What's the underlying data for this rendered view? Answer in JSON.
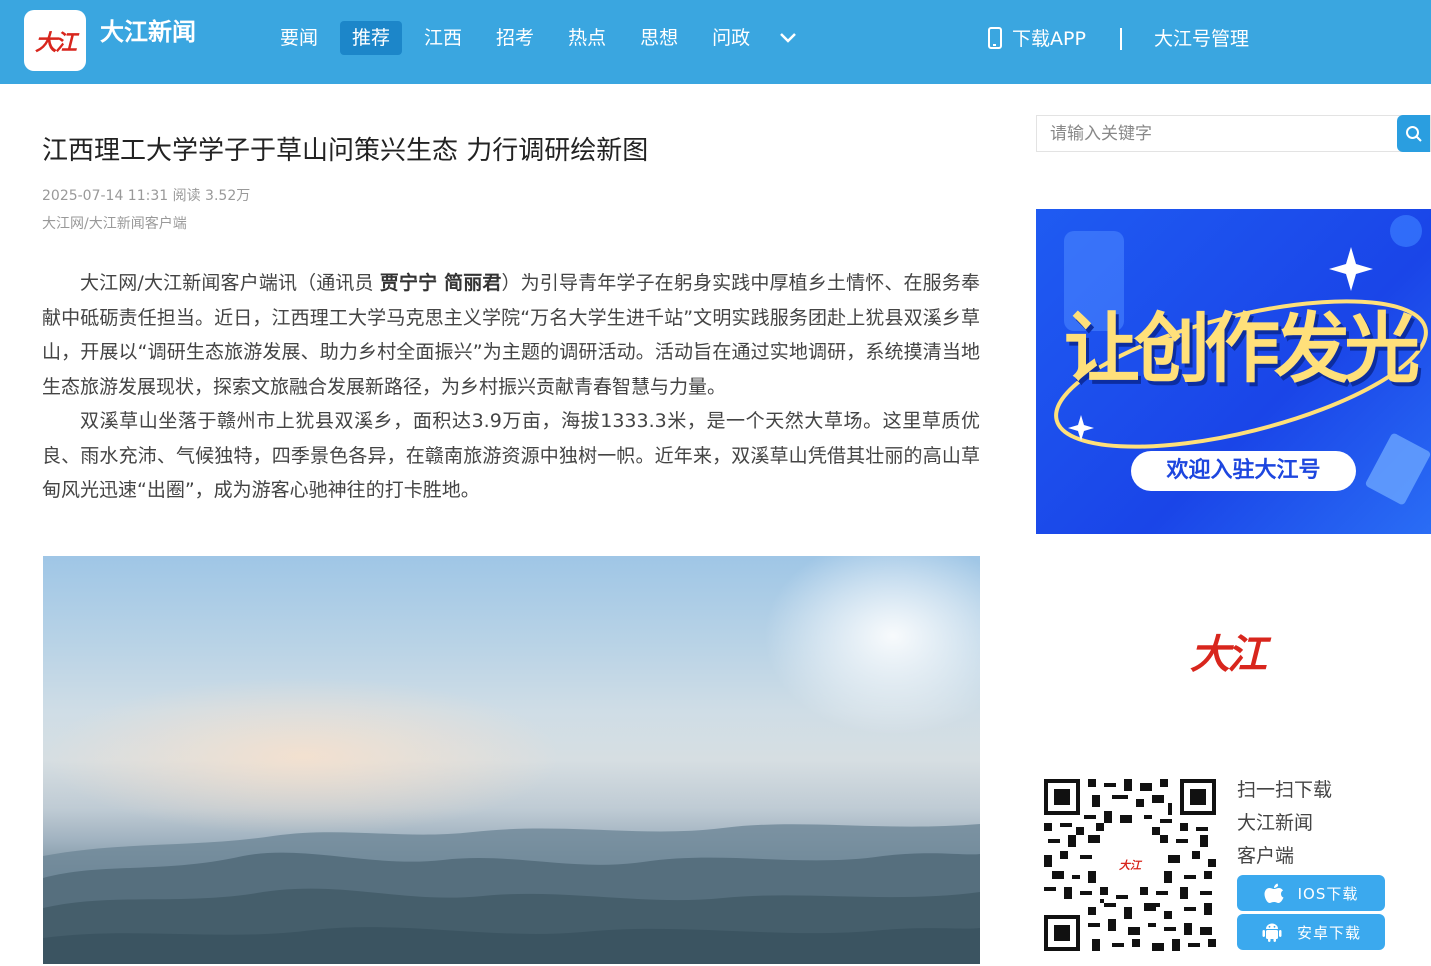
{
  "header": {
    "logo_text": "大江",
    "brand": "大江新闻",
    "nav": [
      "要闻",
      "推荐",
      "江西",
      "招考",
      "热点",
      "思想",
      "问政"
    ],
    "active_nav": "推荐",
    "download_label": "下载APP",
    "manage_label": "大江号管理"
  },
  "article": {
    "title": "江西理工大学学子于草山问策兴生态 力行调研绘新图",
    "meta": "2025-07-14 11:31 阅读 3.52万",
    "source": "大江网/大江新闻客户端",
    "p1_pre": "大江网/大江新闻客户端讯（通讯员 ",
    "p1_bold": "贾宁宁 简丽君",
    "p1_post": "）为引导青年学子在躬身实践中厚植乡土情怀、在服务奉献中砥砺责任担当。近日，江西理工大学马克思主义学院“万名大学生进千站”文明实践服务团赴上犹县双溪乡草山，开展以“调研生态旅游发展、助力乡村全面振兴”为主题的调研活动。活动旨在通过实地调研，系统摸清当地生态旅游发展现状，探索文旅融合发展新路径，为乡村振兴贡献青春智慧与力量。",
    "p2": "双溪草山坐落于赣州市上犹县双溪乡，面积达3.9万亩，海拔1333.3米，是一个天然大草场。这里草质优良、雨水充沛、气候独特，四季景色各异，在赣南旅游资源中独树一帜。近年来，双溪草山凭借其壮丽的高山草甸风光迅速“出圈”，成为游客心驰神往的打卡胜地。"
  },
  "sidebar": {
    "search_placeholder": "请输入关键字",
    "banner_title": "让创作发光",
    "banner_pill": "欢迎入驻大江号",
    "logo_text": "大江",
    "scan_lines": [
      "扫一扫下载",
      "大江新闻",
      "客户端"
    ],
    "qr_center": "大江",
    "ios_label": "IOS下载",
    "android_label": "安卓下载"
  },
  "colors": {
    "header_bg": "#3aa6e0",
    "active_nav_bg": "#1c86c9",
    "brand_red": "#d8261d",
    "button_blue": "#3ba9ee"
  }
}
